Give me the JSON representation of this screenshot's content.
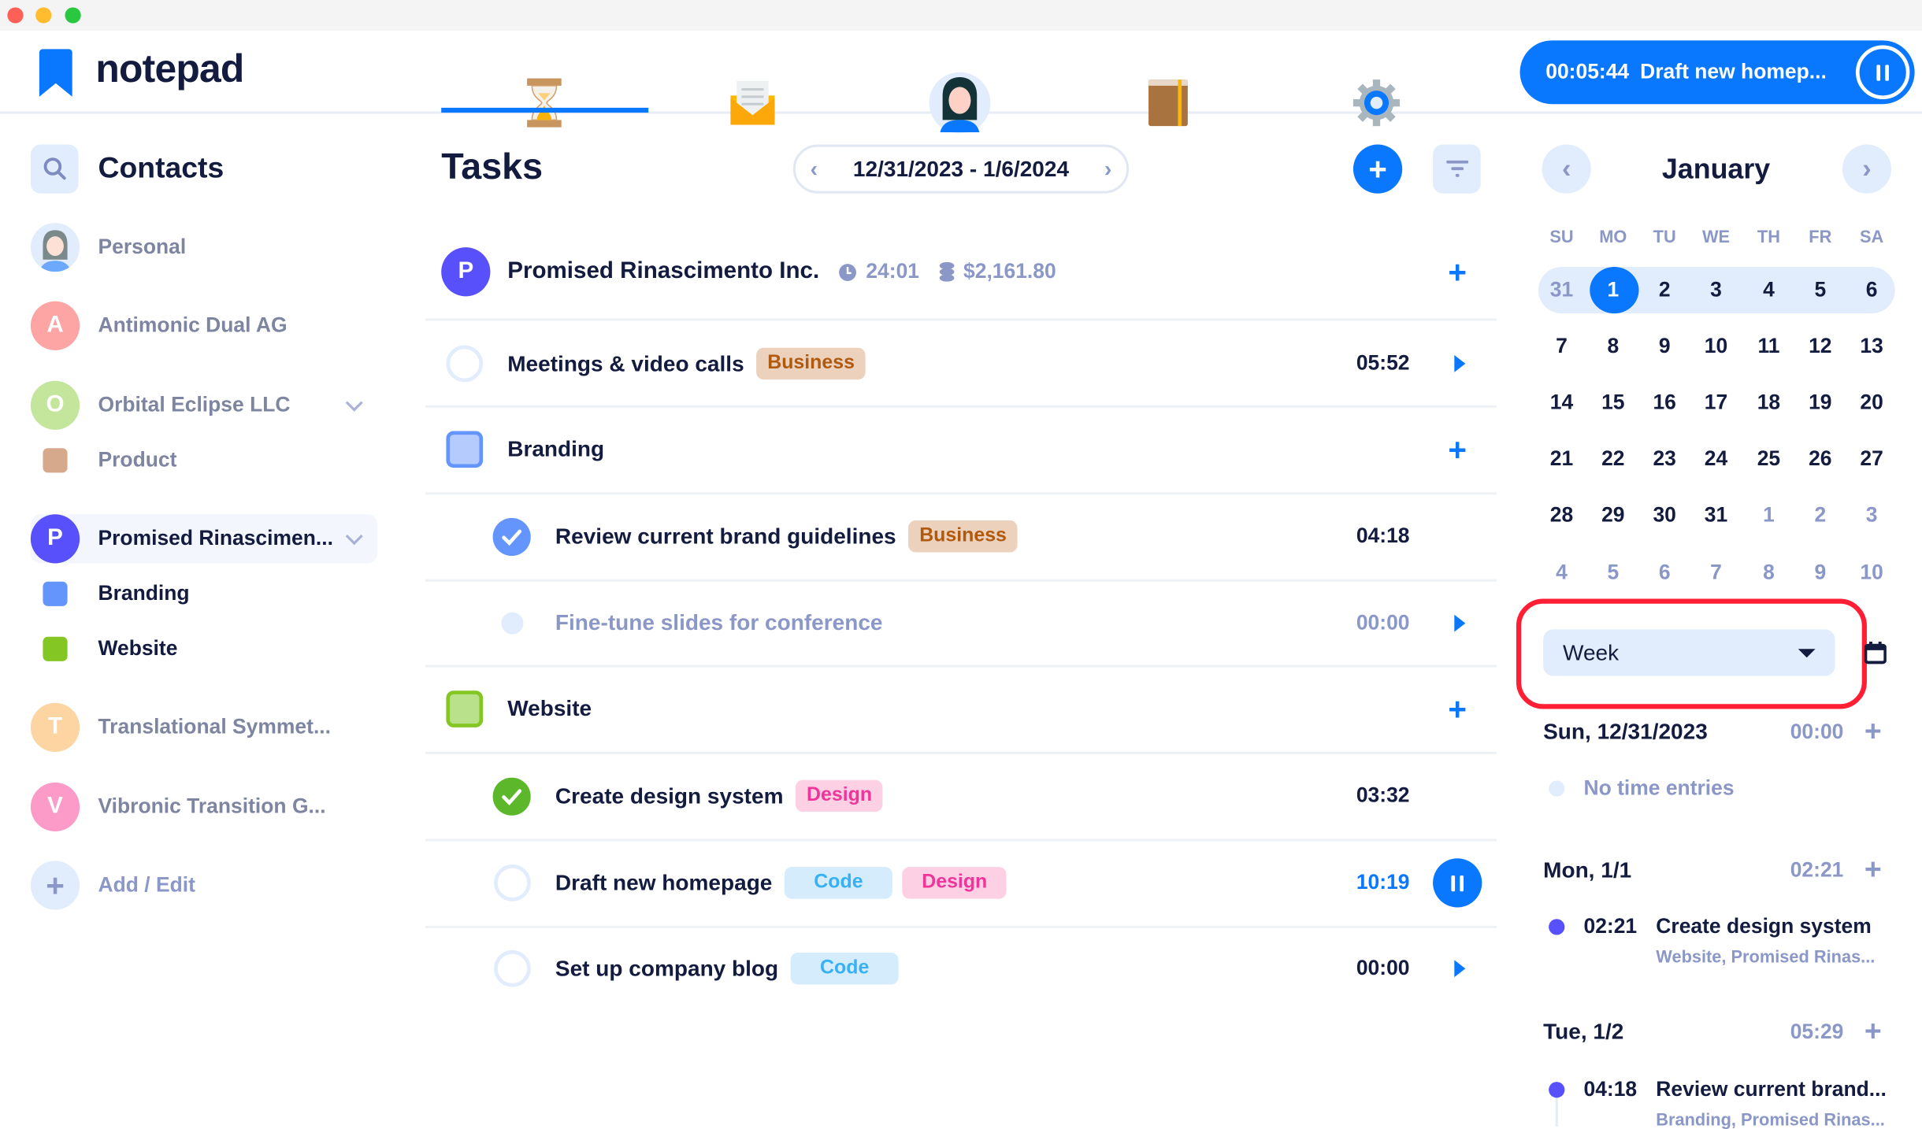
{
  "app": {
    "name": "notepad",
    "accent": "#0a77ff"
  },
  "nav": {
    "tabs": [
      {
        "icon": "hourglass-icon",
        "active": true
      },
      {
        "icon": "envelope-icon",
        "active": false
      },
      {
        "icon": "profile-avatar-icon",
        "active": false
      },
      {
        "icon": "book-icon",
        "active": false
      },
      {
        "icon": "gear-icon",
        "active": false
      }
    ]
  },
  "timer": {
    "elapsed": "00:05:44",
    "task": "Draft new homep...",
    "icon": "pause-icon"
  },
  "sidebar": {
    "title": "Contacts",
    "search_icon": "search-icon",
    "items": [
      {
        "label": "Personal",
        "type": "avatar-photo"
      },
      {
        "label": "Antimonic Dual AG",
        "initial": "A",
        "color": "#fda4a4"
      },
      {
        "label": "Orbital Eclipse LLC",
        "initial": "O",
        "color": "#c3e59c",
        "expanded": true
      },
      {
        "label": "Product",
        "color": "#d6a98c",
        "sub": true
      },
      {
        "label": "Promised Rinascimen...",
        "initial": "P",
        "color": "#5750fb",
        "expanded": true,
        "selected": true
      },
      {
        "label": "Branding",
        "color": "#6495fc",
        "sub": true
      },
      {
        "label": "Website",
        "color": "#84c623",
        "sub": true
      },
      {
        "label": "Translational Symmet...",
        "initial": "T",
        "color": "#fdd5a3"
      },
      {
        "label": "Vibronic Transition G...",
        "initial": "V",
        "color": "#fc9bc7"
      }
    ],
    "add_label": "Add / Edit"
  },
  "tasks": {
    "title": "Tasks",
    "date_range": "12/31/2023 - 1/6/2024",
    "client": {
      "initial": "P",
      "name": "Promised Rinascimento Inc.",
      "time": "24:01",
      "amount": "$2,161.80"
    },
    "rows": [
      {
        "kind": "task",
        "name": "Meetings & video calls",
        "tags": [
          "Business"
        ],
        "duration": "05:52",
        "state": "open",
        "action": "play"
      },
      {
        "kind": "project",
        "name": "Branding",
        "color": "#6495fc"
      },
      {
        "kind": "task",
        "name": "Review current brand guidelines",
        "tags": [
          "Business"
        ],
        "duration": "04:18",
        "state": "done-blue",
        "indent": true
      },
      {
        "kind": "task",
        "name": "Fine-tune slides for conference",
        "tags": [],
        "duration": "00:00",
        "state": "muted",
        "indent": true,
        "action": "play"
      },
      {
        "kind": "project",
        "name": "Website",
        "color": "#84c623"
      },
      {
        "kind": "task",
        "name": "Create design system",
        "tags": [
          "Design"
        ],
        "duration": "03:32",
        "state": "done-green",
        "indent": true
      },
      {
        "kind": "task",
        "name": "Draft new homepage",
        "tags": [
          "Code",
          "Design"
        ],
        "duration": "10:19",
        "state": "open",
        "indent": true,
        "action": "pause",
        "running": true
      },
      {
        "kind": "task",
        "name": "Set up company blog",
        "tags": [
          "Code"
        ],
        "duration": "00:00",
        "state": "open",
        "indent": true,
        "action": "play"
      }
    ]
  },
  "calendar": {
    "month": "January",
    "weekdays": [
      "SU",
      "MO",
      "TU",
      "WE",
      "TH",
      "FR",
      "SA"
    ],
    "weeks": [
      [
        "31",
        "1",
        "2",
        "3",
        "4",
        "5",
        "6"
      ],
      [
        "7",
        "8",
        "9",
        "10",
        "11",
        "12",
        "13"
      ],
      [
        "14",
        "15",
        "16",
        "17",
        "18",
        "19",
        "20"
      ],
      [
        "21",
        "22",
        "23",
        "24",
        "25",
        "26",
        "27"
      ],
      [
        "28",
        "29",
        "30",
        "31",
        "1",
        "2",
        "3"
      ],
      [
        "4",
        "5",
        "6",
        "7",
        "8",
        "9",
        "10"
      ]
    ],
    "selected_day": "1",
    "highlighted_week": 0,
    "view": "Week"
  },
  "timeline": {
    "days": [
      {
        "label": "Sun, 12/31/2023",
        "total": "00:00",
        "empty_text": "No time entries",
        "entries": []
      },
      {
        "label": "Mon, 1/1",
        "total": "02:21",
        "entries": [
          {
            "time": "02:21",
            "title": "Create design system",
            "subtitle": "Website, Promised Rinas..."
          }
        ]
      },
      {
        "label": "Tue, 1/2",
        "total": "05:29",
        "entries": [
          {
            "time": "04:18",
            "title": "Review current brand...",
            "subtitle": "Branding, Promised Rinas..."
          }
        ]
      }
    ]
  }
}
